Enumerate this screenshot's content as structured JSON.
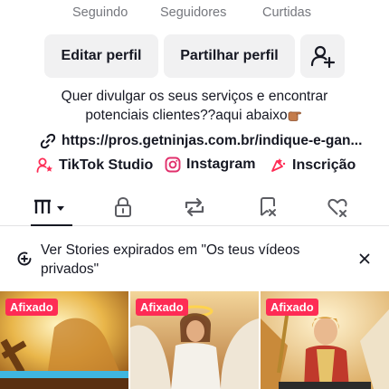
{
  "stats": {
    "following_label": "Seguindo",
    "followers_label": "Seguidores",
    "likes_label": "Curtidas"
  },
  "buttons": {
    "edit_profile": "Editar perfil",
    "share_profile": "Partilhar perfil",
    "add_friend_icon": "person-plus-icon"
  },
  "bio": {
    "line1": "Quer divulgar os seus serviços e encontrar",
    "line2": "potenciais clientes??aqui abaixo",
    "emoji": "pointing-hand-emoji"
  },
  "link": {
    "text": "https://pros.getninjas.com.br/indique-e-gan..."
  },
  "social": {
    "tiktok_studio": "TikTok Studio",
    "instagram": "Instagram",
    "inscricao": "Inscrição"
  },
  "tabs": [
    {
      "name": "videos-grid",
      "icon": "grid-icon",
      "active": true
    },
    {
      "name": "private",
      "icon": "lock-icon",
      "active": false
    },
    {
      "name": "reposts",
      "icon": "repost-icon",
      "active": false
    },
    {
      "name": "favorites",
      "icon": "bookmark-icon",
      "active": false
    },
    {
      "name": "liked",
      "icon": "heart-icon",
      "active": false
    }
  ],
  "stories_banner": {
    "text": "Ver Stories expirados em \"Os teus vídeos privados\""
  },
  "videos": [
    {
      "badge": "Afixado"
    },
    {
      "badge": "Afixado"
    },
    {
      "badge": "Afixado"
    }
  ],
  "colors": {
    "accent": "#fe2c55",
    "text": "#161823",
    "muted": "#75777d",
    "button_bg": "#f1f1f2"
  }
}
